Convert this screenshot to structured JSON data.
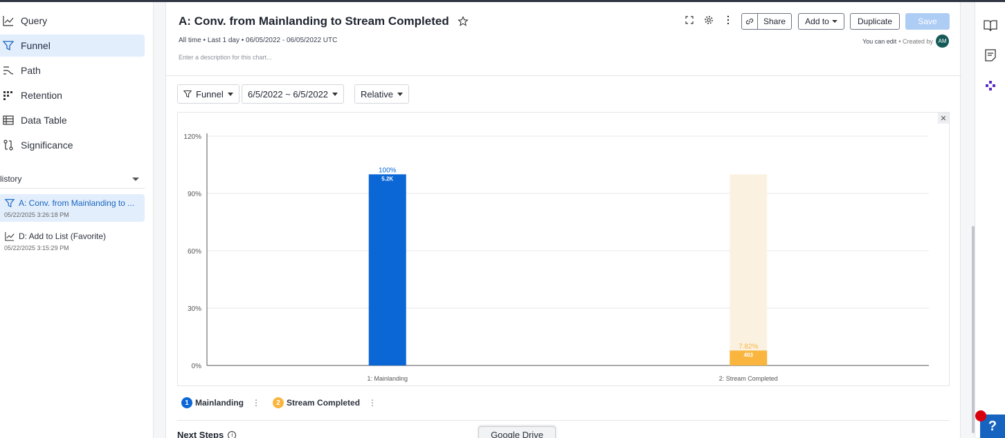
{
  "sidebar": {
    "nav": [
      {
        "label": "Query",
        "icon": "line-chart-icon"
      },
      {
        "label": "Funnel",
        "icon": "funnel-icon"
      },
      {
        "label": "Path",
        "icon": "path-icon"
      },
      {
        "label": "Retention",
        "icon": "retention-icon"
      },
      {
        "label": "Data Table",
        "icon": "table-icon"
      },
      {
        "label": "Significance",
        "icon": "significance-icon"
      }
    ],
    "history_label": "listory",
    "history": [
      {
        "title": "A: Conv. from Mainlanding to ...",
        "time": "05/22/2025 3:26:18 PM"
      },
      {
        "title": "D: Add to List (Favorite)",
        "time": "05/22/2025 3:15:29 PM"
      }
    ]
  },
  "header": {
    "title": "A: Conv. from Mainlanding to Stream Completed",
    "meta": "All time • Last 1 day • 06/05/2022 - 06/05/2022 UTC",
    "description_placeholder": "Enter a description for this chart...",
    "share_label": "Share",
    "add_to_label": "Add to",
    "duplicate_label": "Duplicate",
    "save_label": "Save",
    "you_can_edit": "You can edit",
    "created_by": "• Created by",
    "avatar_initials": "AM"
  },
  "controls": {
    "chart_type": "Funnel",
    "date_range": "6/5/2022 ~ 6/5/2022",
    "mode": "Relative"
  },
  "chart_data": {
    "type": "bar",
    "categories": [
      "1: Mainlanding",
      "2: Stream Completed"
    ],
    "percent": [
      100,
      7.82
    ],
    "percent_labels": [
      "100%",
      "7.82%"
    ],
    "count_labels": [
      "5.2K",
      "403"
    ],
    "yticks": [
      "0%",
      "30%",
      "60%",
      "90%",
      "120%"
    ],
    "ylim": [
      0,
      120
    ],
    "colors": [
      "#0b67d6",
      "#f9b53e"
    ],
    "dropoff_color": "#fbf1e1",
    "grid": true
  },
  "legend": [
    {
      "num": "1",
      "label": "Mainlanding",
      "color": "#0b67d6"
    },
    {
      "num": "2",
      "label": "Stream Completed",
      "color": "#f9b53e"
    }
  ],
  "next_steps_label": "Next Steps",
  "gdrive_label": "Google Drive",
  "help_label": "?"
}
